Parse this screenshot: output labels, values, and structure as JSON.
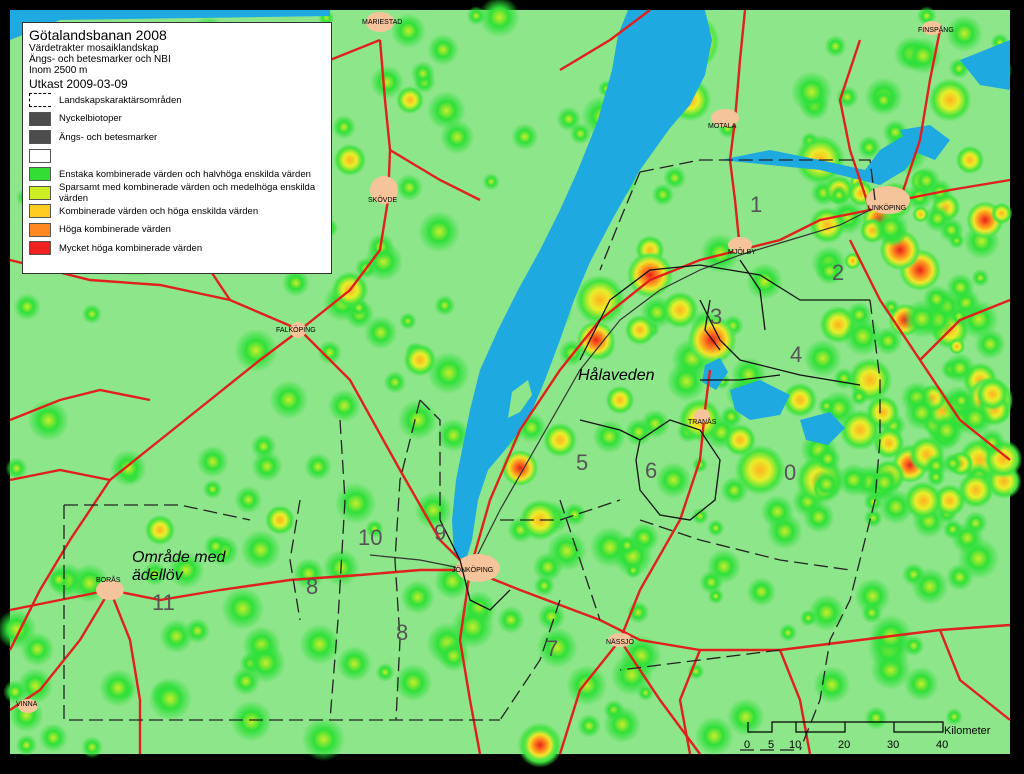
{
  "legend": {
    "title": "Götalandsbanan 2008",
    "subtitle_lines": [
      "Värdetrakter mosaiklandskap",
      "Ängs- och betesmarker och NBI",
      "Inom 2500 m"
    ],
    "date": "Utkast 2009-03-09",
    "items": [
      {
        "label": "Landskapskaraktärsområden",
        "color": "#ffffff",
        "style": "dashed"
      },
      {
        "label": "Nyckelbiotoper",
        "color": "#4d4d4d",
        "style": "fill"
      },
      {
        "label": "Ängs- och betesmarker",
        "color": "#4d4d4d",
        "style": "fill"
      },
      {
        "label": "",
        "color": "#ffffff",
        "style": "fill"
      },
      {
        "label": "Enstaka  kombinerade värden och halvhöga enskilda värden",
        "color": "#33dd33",
        "style": "fill"
      },
      {
        "label": "Sparsamt med kombinerade värden och medelhöga enskilda värden",
        "color": "#ccee22",
        "style": "fill"
      },
      {
        "label": "Kombinerade värden och höga enskilda värden",
        "color": "#ffcc22",
        "style": "fill"
      },
      {
        "label": "Höga kombinerade värden",
        "color": "#ff8822",
        "style": "fill"
      },
      {
        "label": "Mycket höga kombinerade värden",
        "color": "#ee2222",
        "style": "fill"
      }
    ]
  },
  "cities": {
    "mariestad": "MARIESTAD",
    "finspang": "FINSPÅNG",
    "motala": "MOTALA",
    "skovde": "SKÖVDE",
    "linkoping": "LINKÖPING",
    "mjolby": "MJÖLBY",
    "falkoping": "FALKÖPING",
    "tranas": "TRANÅS",
    "jonkoping": "JÖNKÖPING",
    "boras": "BORÅS",
    "nassjo": "NÄSSJÖ",
    "vinna": "VINNA"
  },
  "zones": {
    "z1": "1",
    "z2": "2",
    "z3": "3",
    "z4": "4",
    "z5": "5",
    "z6": "6",
    "z0": "0",
    "z10": "10",
    "z9": "9",
    "z8a": "8",
    "z8b": "8",
    "z11": "11",
    "z7": "7"
  },
  "areas": {
    "halaveden": "Hålaveden",
    "adellov_1": "Område med",
    "adellov_2": "ädellöv"
  },
  "scale": {
    "unit": "Kilometer",
    "ticks": [
      "0",
      "5",
      "10",
      "20",
      "30",
      "40"
    ]
  },
  "colors": {
    "background": "#8ee68a",
    "water": "#1ea9e1",
    "road": "#e0201c",
    "urban": "#f6c49a"
  }
}
